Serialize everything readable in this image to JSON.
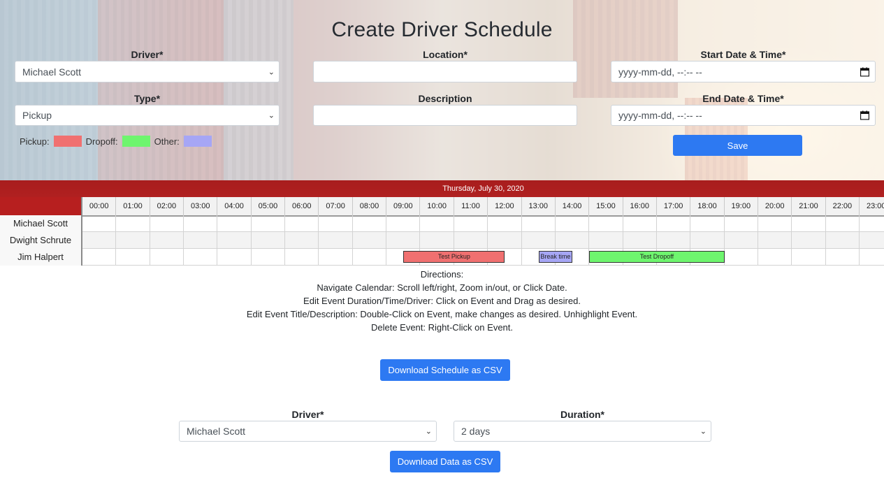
{
  "page_title": "Create Driver Schedule",
  "form": {
    "driver": {
      "label": "Driver*",
      "value": "Michael Scott"
    },
    "location": {
      "label": "Location*",
      "value": ""
    },
    "start": {
      "label": "Start Date & Time*",
      "placeholder": "yyyy-mm-dd, --:-- --"
    },
    "type": {
      "label": "Type*",
      "value": "Pickup"
    },
    "description": {
      "label": "Description",
      "value": ""
    },
    "end": {
      "label": "End Date & Time*",
      "placeholder": "yyyy-mm-dd, --:-- --"
    },
    "save_label": "Save"
  },
  "legend": {
    "pickup": {
      "label": "Pickup:",
      "color": "#f07070"
    },
    "dropoff": {
      "label": "Dropoff:",
      "color": "#6ef56e"
    },
    "other": {
      "label": "Other:",
      "color": "#a6a6f5"
    }
  },
  "scheduler": {
    "date": "Thursday, July 30, 2020",
    "hours": [
      "00:00",
      "01:00",
      "02:00",
      "03:00",
      "04:00",
      "05:00",
      "06:00",
      "07:00",
      "08:00",
      "09:00",
      "10:00",
      "11:00",
      "12:00",
      "13:00",
      "14:00",
      "15:00",
      "16:00",
      "17:00",
      "18:00",
      "19:00",
      "20:00",
      "21:00",
      "22:00",
      "23:00"
    ],
    "drivers": [
      "Michael Scott",
      "Dwight Schrute",
      "Jim Halpert"
    ],
    "events": [
      {
        "title": "Test Pickup",
        "driver": "Jim Halpert",
        "type": "pickup",
        "start": "09:30",
        "end": "12:30",
        "color": "#f07070"
      },
      {
        "title": "Break time",
        "driver": "Jim Halpert",
        "type": "other",
        "start": "13:30",
        "end": "14:30",
        "color": "#a6a6f5"
      },
      {
        "title": "Test Dropoff",
        "driver": "Jim Halpert",
        "type": "dropoff",
        "start": "15:00",
        "end": "19:00",
        "color": "#6ef56e"
      }
    ]
  },
  "directions": {
    "heading": "Directions:",
    "lines": [
      "Navigate Calendar: Scroll left/right, Zoom in/out, or Click Date.",
      "Edit Event Duration/Time/Driver: Click on Event and Drag as desired.",
      "Edit Event Title/Description: Double-Click on Event, make changes as desired. Unhighlight Event.",
      "Delete Event: Right-Click on Event."
    ]
  },
  "download_schedule_label": "Download Schedule as CSV",
  "export": {
    "driver": {
      "label": "Driver*",
      "value": "Michael Scott"
    },
    "duration": {
      "label": "Duration*",
      "value": "2 days"
    },
    "download_label": "Download Data as CSV"
  }
}
